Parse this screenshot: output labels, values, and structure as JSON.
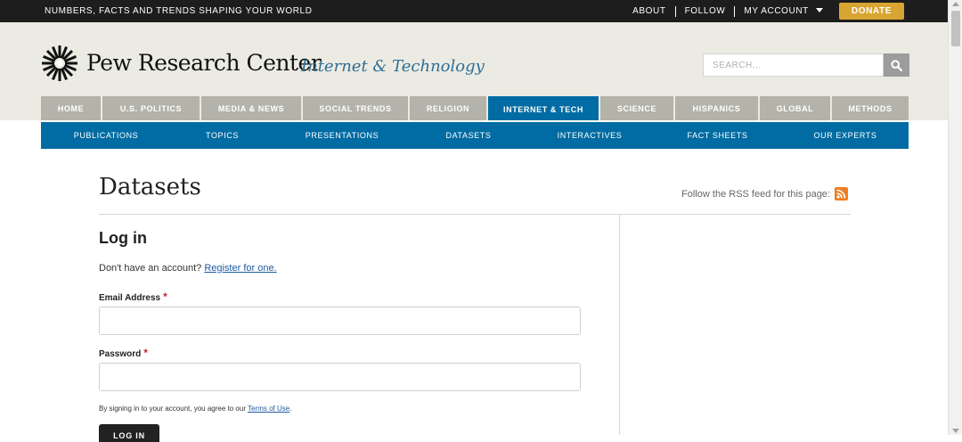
{
  "topbar": {
    "tagline": "NUMBERS, FACTS AND TRENDS SHAPING YOUR WORLD",
    "about": "ABOUT",
    "follow": "FOLLOW",
    "account": "MY ACCOUNT",
    "donate": "DONATE"
  },
  "header": {
    "logo": "Pew Research Center",
    "section": "Internet & Technology",
    "search_placeholder": "SEARCH..."
  },
  "mainnav": [
    "HOME",
    "U.S. POLITICS",
    "MEDIA & NEWS",
    "SOCIAL TRENDS",
    "RELIGION",
    "INTERNET & TECH",
    "SCIENCE",
    "HISPANICS",
    "GLOBAL",
    "METHODS"
  ],
  "subnav": [
    "PUBLICATIONS",
    "TOPICS",
    "PRESENTATIONS",
    "DATASETS",
    "INTERACTIVES",
    "FACT SHEETS",
    "OUR EXPERTS"
  ],
  "content": {
    "title": "Datasets",
    "rss_text": "Follow the RSS feed for this page:",
    "login_heading": "Log in",
    "no_account": "Don't have an account?",
    "register_link": "Register for one.",
    "email_label": "Email Address",
    "password_label": "Password",
    "required_mark": "*",
    "agree_text": "By signing in to your account, you agree to our",
    "terms_link": "Terms of Use",
    "terms_end": ".",
    "login_button": "LOG IN"
  },
  "colors": {
    "accent_blue": "#006ca3",
    "donate_gold": "#d9a532",
    "nav_gray": "#b4b3aa",
    "rss_orange": "#ef7d22"
  },
  "icons": [
    "logo-sunburst-icon",
    "caret-down-icon",
    "search-icon",
    "rss-icon"
  ]
}
